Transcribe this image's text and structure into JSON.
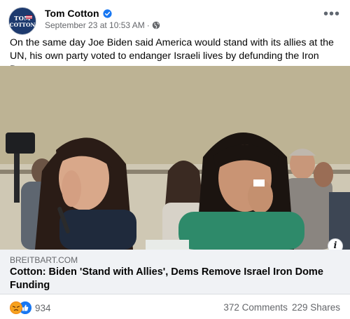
{
  "post": {
    "author": "Tom Cotton",
    "timestamp": "September 23 at 10:53 AM",
    "audience_icon": "globe-icon",
    "avatar_logo": {
      "line1": "TOM",
      "line2": "COTTON"
    },
    "text": "On the same day Joe Biden said America would stand with its allies at the UN, his own party voted to endanger Israeli lives by defunding the Iron Dome."
  },
  "link_preview": {
    "domain": "BREITBART.COM",
    "title": "Cotton: Biden 'Stand with Allies', Dems Remove Israel Iron Dome Funding"
  },
  "footer": {
    "reaction_count": "934",
    "reaction_icons": [
      "angry-reaction-icon",
      "like-reaction-icon"
    ],
    "comments": "372 Comments",
    "shares": "229 Shares"
  },
  "colors": {
    "text_primary": "#050505",
    "text_secondary": "#65676b",
    "verified_blue": "#1877f2",
    "link_preview_bg": "#f0f2f5"
  }
}
